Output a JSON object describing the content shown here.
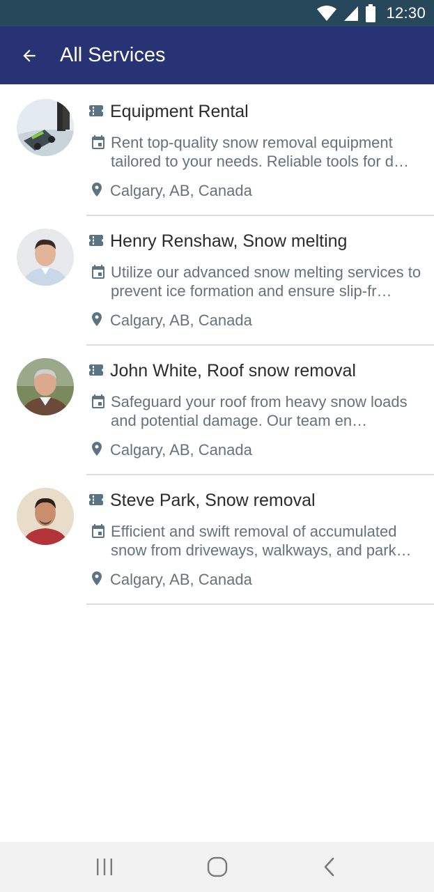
{
  "status_bar": {
    "time": "12:30",
    "icons": [
      "wifi-icon",
      "cell-signal-icon",
      "battery-icon"
    ]
  },
  "app_bar": {
    "title": "All Services",
    "back_icon": "arrow-left-icon",
    "background": "#283376"
  },
  "colors": {
    "status_bar": "#27475a",
    "icon": "#5c7384",
    "title_text": "#2b2b2b",
    "secondary_text": "#65727c"
  },
  "services": [
    {
      "title": "Equipment Rental",
      "description": "Rent top-quality snow removal equipment tailored to your needs. Reliable tools for d…",
      "location": "Calgary, AB, Canada",
      "avatar": "snow-equipment-photo"
    },
    {
      "title": "Henry Renshaw, Snow melting",
      "description": "Utilize our advanced snow melting services to prevent ice formation and ensure slip-fr…",
      "location": "Calgary, AB, Canada",
      "avatar": "person-photo"
    },
    {
      "title": "John White, Roof snow removal",
      "description": "Safeguard your roof from heavy snow loads and potential damage. Our team en…",
      "location": "Calgary, AB, Canada",
      "avatar": "person-photo"
    },
    {
      "title": "Steve Park, Snow removal",
      "description": "Efficient and swift removal of accumulated snow from driveways, walkways, and park…",
      "location": "Calgary, AB, Canada",
      "avatar": "person-photo"
    }
  ],
  "nav_bar": {
    "buttons": [
      "recent-apps-icon",
      "home-icon",
      "back-icon"
    ]
  }
}
